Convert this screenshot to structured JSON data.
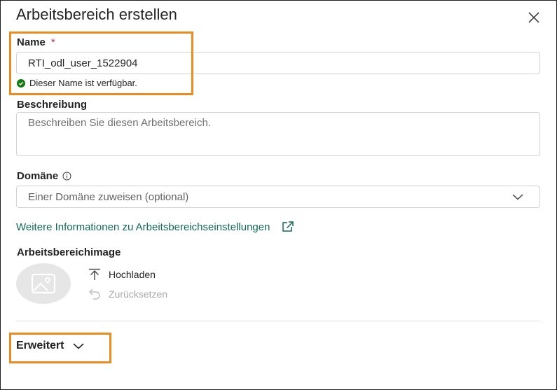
{
  "dialog": {
    "title": "Arbeitsbereich erstellen",
    "close_icon": "close-icon"
  },
  "name_field": {
    "label": "Name",
    "required_marker": "*",
    "value": "RTI_odl_user_1522904",
    "availability_message": "Dieser Name ist verfügbar.",
    "status_color": "#107c10"
  },
  "description_field": {
    "label": "Beschreibung",
    "placeholder": "Beschreiben Sie diesen Arbeitsbereich."
  },
  "domain_field": {
    "label": "Domäne",
    "info_icon": "info-icon",
    "selected_value": "Einer Domäne zuweisen (optional)"
  },
  "more_info_link": {
    "text": "Weitere Informationen zu Arbeitsbereichseinstellungen",
    "icon": "open-external-icon",
    "color": "#0f6b55"
  },
  "image_section": {
    "label": "Arbeitsbereichimage",
    "upload_label": "Hochladen",
    "reset_label": "Zurücksetzen"
  },
  "advanced": {
    "label": "Erweitert"
  },
  "highlight_color": "#ef8a1d"
}
